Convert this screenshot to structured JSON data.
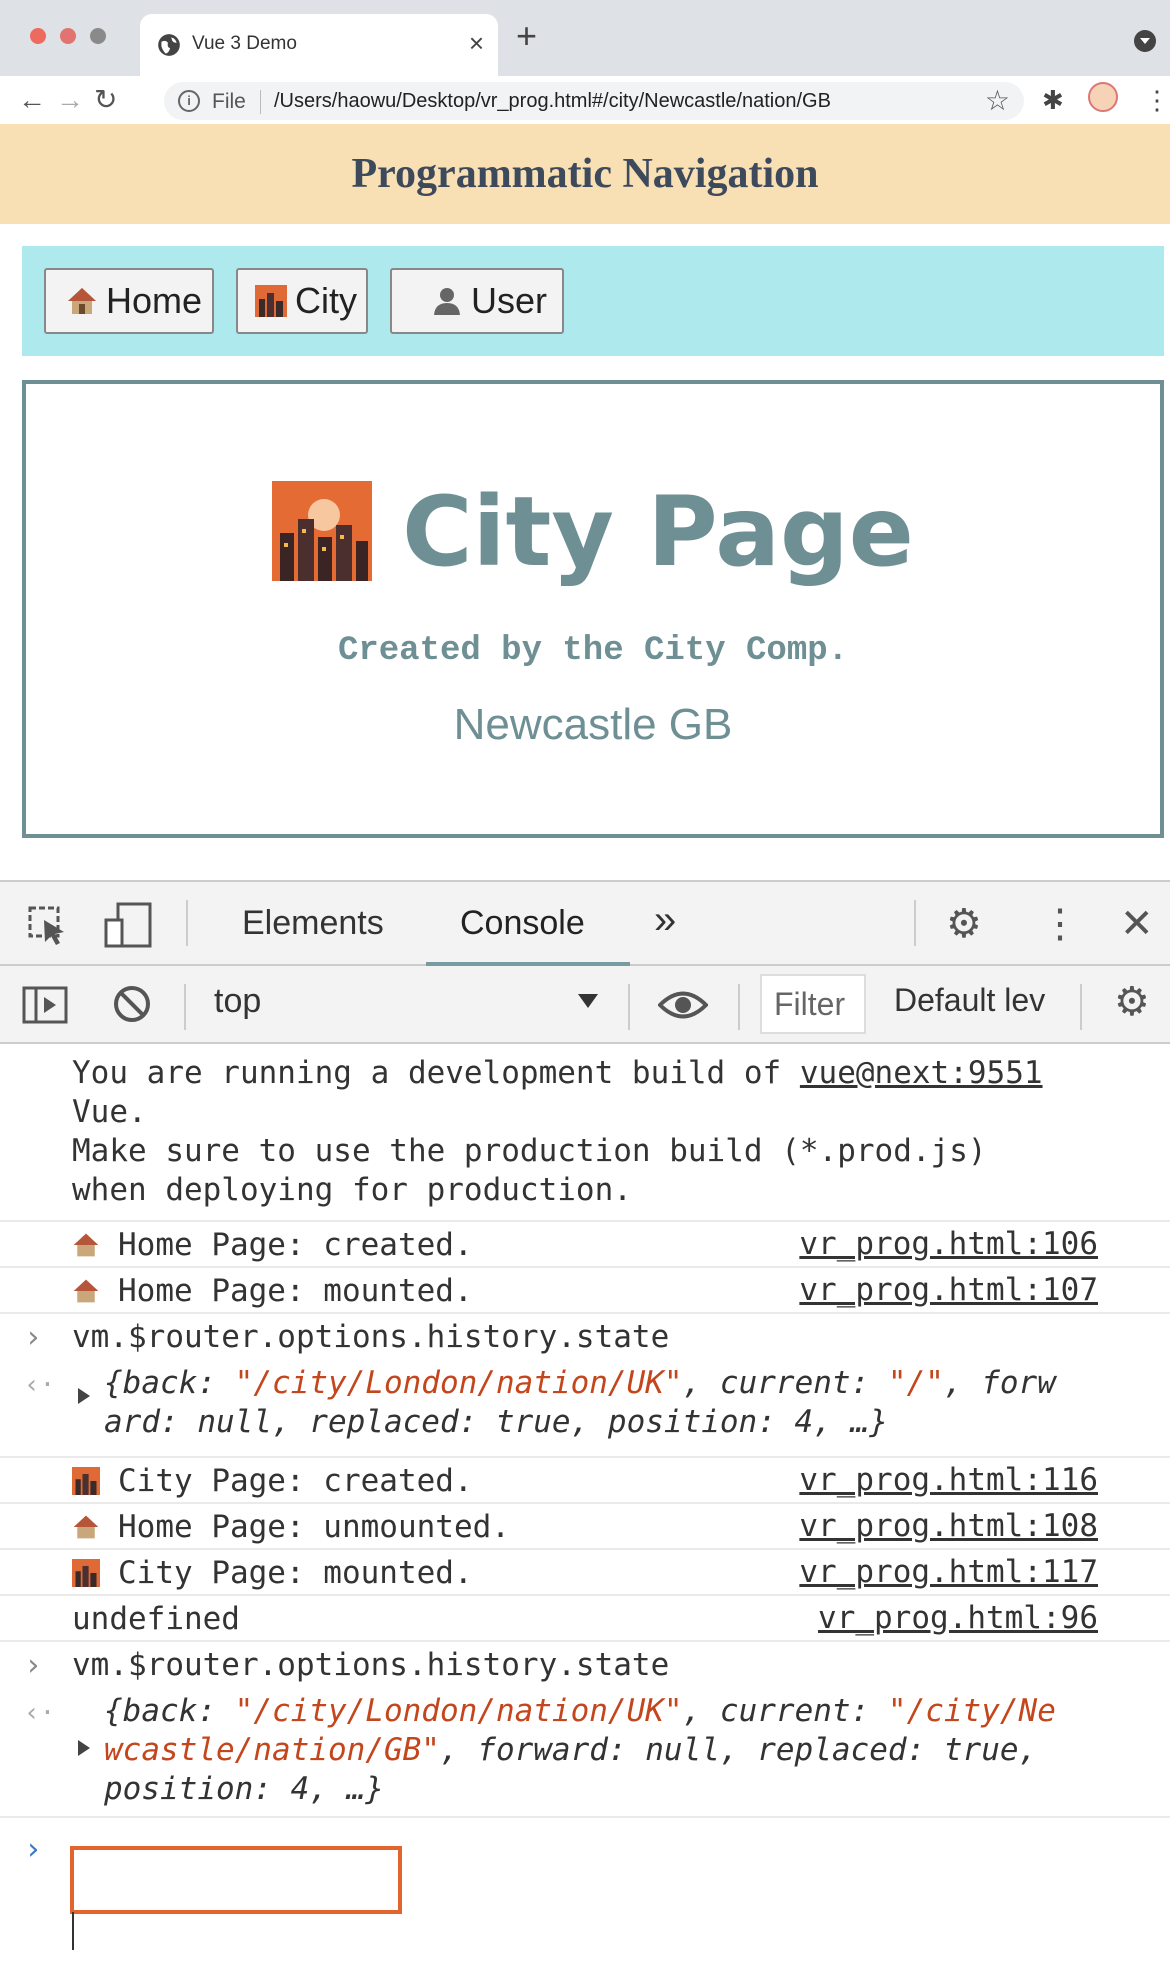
{
  "browser": {
    "tab_title": "Vue 3 Demo",
    "tab_close": "×",
    "new_tab": "+",
    "url_scheme_label": "File",
    "url": "/Users/haowu/Desktop/vr_prog.html#/city/Newcastle/nation/GB"
  },
  "page": {
    "header_title": "Programmatic Navigation",
    "nav": [
      {
        "label": "Home",
        "icon": "house-icon"
      },
      {
        "label": "City",
        "icon": "city-icon"
      },
      {
        "label": "User",
        "icon": "user-icon"
      }
    ],
    "city_title": "City Page",
    "created_by": "Created by the City Comp.",
    "location": "Newcastle GB"
  },
  "devtools": {
    "tabs": {
      "elements": "Elements",
      "console": "Console",
      "more": "»"
    },
    "context": "top",
    "filter_placeholder": "Filter",
    "level": "Default lev",
    "console": {
      "vue_warning": {
        "line1": "You are running a development build of ",
        "link": "vue@next:9551",
        "line2": "Vue.",
        "line3": "Make sure to use the production build (*.prod.js)",
        "line4": "when deploying for production."
      },
      "logs": [
        {
          "text": "Home Page: created.",
          "src": "vr_prog.html:106"
        },
        {
          "text": "Home Page: mounted.",
          "src": "vr_prog.html:107"
        }
      ],
      "input1": "vm.$router.options.history.state",
      "result1": {
        "line1_a": "{back: ",
        "line1_b": "\"/city/London/nation/UK\"",
        "line1_c": ", current: ",
        "line1_d": "\"/\"",
        "line1_e": ", forw",
        "line2": "ard: null, replaced: true, position: 4, …}"
      },
      "logs2": [
        {
          "text": "City Page: created.",
          "src": "vr_prog.html:116"
        },
        {
          "text": "Home Page: unmounted.",
          "src": "vr_prog.html:108"
        },
        {
          "text": "City Page: mounted.",
          "src": "vr_prog.html:117"
        }
      ],
      "undefined_log": {
        "text": "undefined",
        "src": "vr_prog.html:96"
      },
      "input2": "vm.$router.options.history.state",
      "result2": {
        "line1_a": "{back: ",
        "line1_b": "\"/city/London/nation/UK\"",
        "line1_c": ", current: ",
        "line1_d": "\"/city/Ne",
        "line2_a": "wcastle/nation/GB\"",
        "line2_b": ", forward: null, replaced: true,",
        "line3": "position: 4, …}"
      }
    }
  },
  "colors": {
    "header_bg": "#f9dfb4",
    "nav_bg": "#aee9ee",
    "accent": "#6e8f93",
    "string": "#c4461d",
    "highlight": "#e0662e"
  }
}
